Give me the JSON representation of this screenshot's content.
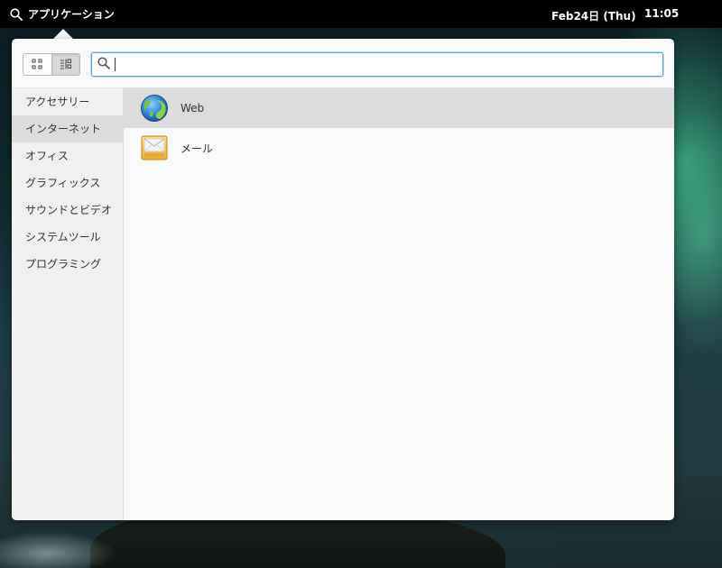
{
  "topbar": {
    "apps_label": "アプリケーション",
    "date": "Feb24日 (Thu)",
    "time": "11:05"
  },
  "search": {
    "value": "",
    "placeholder": ""
  },
  "categories": [
    {
      "label": "アクセサリー"
    },
    {
      "label": "インターネット"
    },
    {
      "label": "オフィス"
    },
    {
      "label": "グラフィックス"
    },
    {
      "label": "サウンドとビデオ"
    },
    {
      "label": "システムツール"
    },
    {
      "label": "プログラミング"
    }
  ],
  "apps": [
    {
      "label": "Web",
      "icon": "globe-icon"
    },
    {
      "label": "メール",
      "icon": "mail-icon"
    }
  ],
  "colors": {
    "accent": "#5da0e0",
    "selection": "#dcdcdc"
  }
}
